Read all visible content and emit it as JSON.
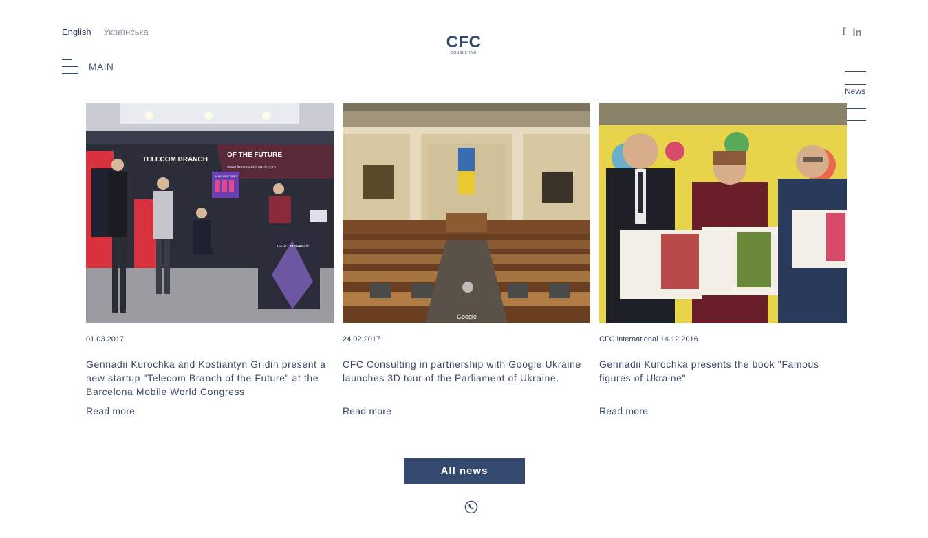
{
  "languages": [
    {
      "label": "English",
      "active": true
    },
    {
      "label": "Українська",
      "active": false
    }
  ],
  "logo": {
    "mark": "CFC",
    "sub": "consulting"
  },
  "social": {
    "facebook": "f",
    "linkedin": "in"
  },
  "menu": {
    "label": "MAIN"
  },
  "side_nav": {
    "active_label": "News"
  },
  "news": [
    {
      "date": "01.03.2017",
      "title": "Gennadii Kurochka and Kostiantyn Gridin present a new startup \"Telecom Branch of the Future\" at the Barcelona Mobile World Congress",
      "read_more": "Read more",
      "image_text": {
        "left": "TELECOM BRANCH",
        "right": "OF THE FUTURE",
        "url": "www.futuretelebranch.com",
        "screen": "MAIN FEATURES",
        "stand": "TELECOM BRANCH"
      }
    },
    {
      "date": "24.02.2017",
      "title": "CFC Consulting in partnership with Google Ukraine launches 3D tour of the Parliament of Ukraine.",
      "read_more": "Read more",
      "image_text": {
        "watermark": "Google"
      }
    },
    {
      "date": "CFC international 14.12.2016",
      "title": "Gennadii Kurochka presents the book \"Famous figures of Ukraine\"",
      "read_more": "Read more"
    }
  ],
  "all_news_button": "All news",
  "icons": {
    "phone": "phone-icon",
    "menu": "hamburger-icon",
    "facebook": "facebook-icon",
    "linkedin": "linkedin-icon"
  },
  "colors": {
    "brand": "#34496e",
    "text": "#3a4a66",
    "muted": "#8a93a3"
  }
}
